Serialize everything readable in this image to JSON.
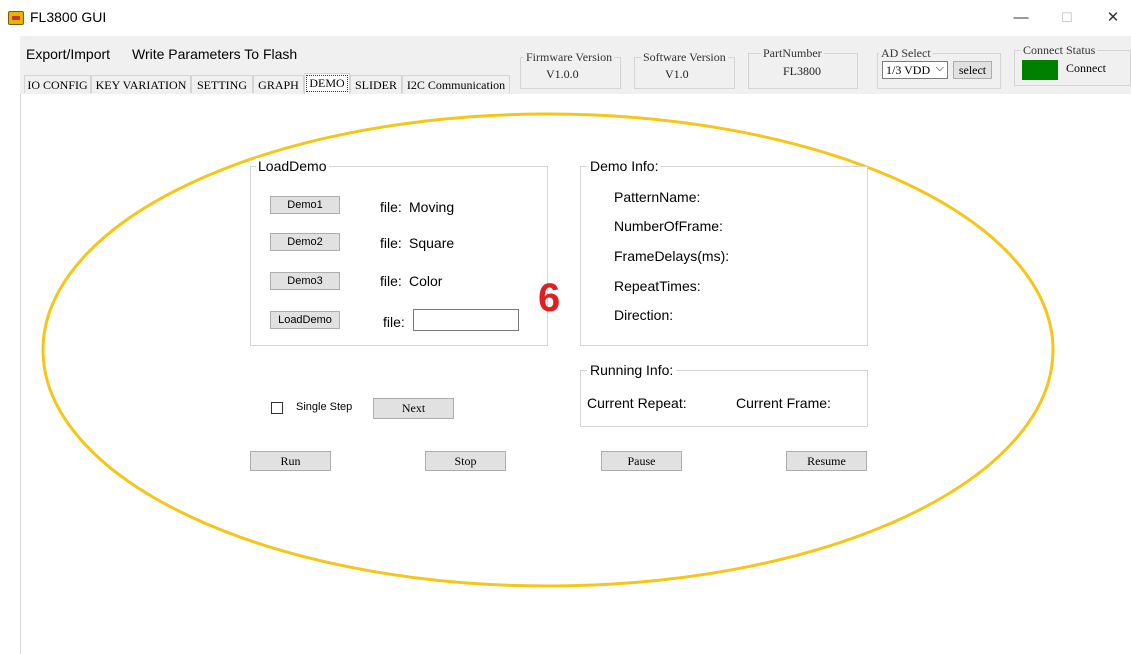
{
  "window": {
    "title": "FL3800 GUI",
    "minimize": "—",
    "maximize": "☐",
    "close": "✕"
  },
  "menu": {
    "export_import": "Export/Import",
    "write_params": "Write Parameters To Flash"
  },
  "header": {
    "firmware": {
      "title": "Firmware Version",
      "value": "V1.0.0"
    },
    "software": {
      "title": "Software Version",
      "value": "V1.0"
    },
    "part": {
      "title": "PartNumber",
      "value": "FL3800"
    },
    "ad_select": {
      "title": "AD Select",
      "value": "1/3 VDD",
      "button": "select"
    },
    "connect": {
      "title": "Connect Status",
      "label": "Connect",
      "color": "#008000"
    }
  },
  "tabs": [
    {
      "label": "IO CONFIG"
    },
    {
      "label": "KEY VARIATION"
    },
    {
      "label": "SETTING"
    },
    {
      "label": "GRAPH"
    },
    {
      "label": "DEMO"
    },
    {
      "label": "SLIDER"
    },
    {
      "label": "I2C Communication"
    }
  ],
  "load_demo": {
    "title": "LoadDemo",
    "rows": [
      {
        "button": "Demo1",
        "file_label": "file:",
        "file_value": "Moving"
      },
      {
        "button": "Demo2",
        "file_label": "file:",
        "file_value": "Square"
      },
      {
        "button": "Demo3",
        "file_label": "file:",
        "file_value": "Color"
      }
    ],
    "load_button": "LoadDemo",
    "file_label": "file:",
    "file_input_value": ""
  },
  "demo_info": {
    "title": "Demo Info:",
    "fields": [
      "PatternName:",
      "NumberOfFrame:",
      "FrameDelays(ms):",
      "RepeatTimes:",
      "Direction:"
    ]
  },
  "running_info": {
    "title": "Running Info:",
    "current_repeat": "Current Repeat:",
    "current_frame": "Current Frame:"
  },
  "controls": {
    "single_step": "Single Step",
    "next": "Next",
    "run": "Run",
    "stop": "Stop",
    "pause": "Pause",
    "resume": "Resume"
  },
  "annotation": {
    "number": "6",
    "ellipse_color": "#f5c518",
    "number_color": "#e02020"
  }
}
